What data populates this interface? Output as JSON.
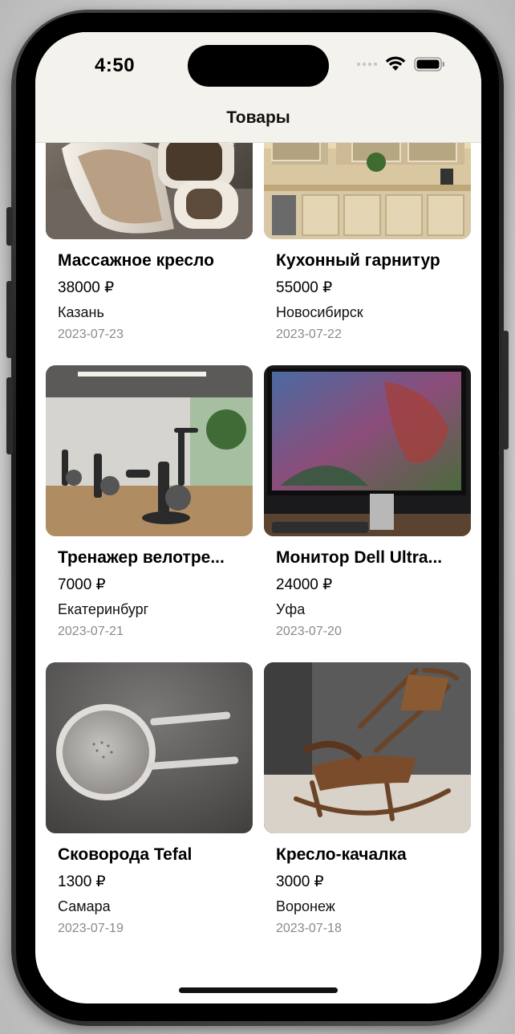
{
  "status_bar": {
    "time": "4:50"
  },
  "nav": {
    "title": "Товары"
  },
  "products": [
    {
      "title": "Массажное кресло",
      "price": "38000 ₽",
      "city": "Казань",
      "date": "2023-07-23",
      "image_icon": "massage-chair-photo"
    },
    {
      "title": "Кухонный гарнитур",
      "price": "55000 ₽",
      "city": "Новосибирск",
      "date": "2023-07-22",
      "image_icon": "kitchen-set-photo"
    },
    {
      "title": "Тренажер велотре...",
      "price": "7000 ₽",
      "city": "Екатеринбург",
      "date": "2023-07-21",
      "image_icon": "exercise-bike-photo"
    },
    {
      "title": "Монитор Dell Ultra...",
      "price": "24000 ₽",
      "city": "Уфа",
      "date": "2023-07-20",
      "image_icon": "monitor-photo"
    },
    {
      "title": "Сковорода Tefal",
      "price": "1300 ₽",
      "city": "Самара",
      "date": "2023-07-19",
      "image_icon": "frying-pan-photo"
    },
    {
      "title": "Кресло-качалка",
      "price": "3000 ₽",
      "city": "Воронеж",
      "date": "2023-07-18",
      "image_icon": "rocking-chair-photo"
    }
  ]
}
